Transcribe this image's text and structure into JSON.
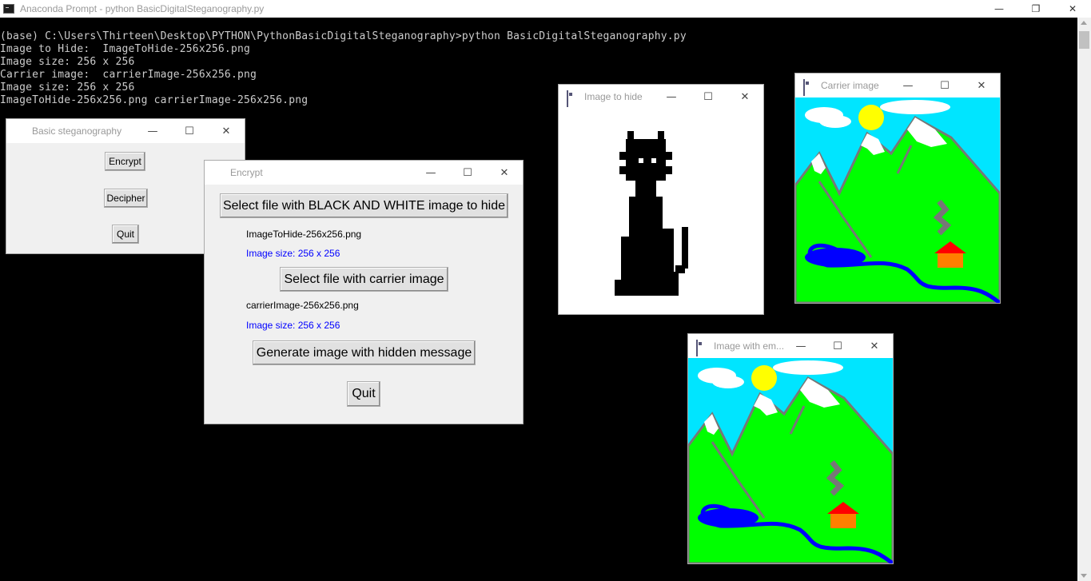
{
  "console": {
    "title": "Anaconda Prompt - python  BasicDigitalSteganography.py",
    "lines": [
      "(base) C:\\Users\\Thirteen\\Desktop\\PYTHON\\PythonBasicDigitalSteganography>python BasicDigitalSteganography.py",
      "Image to Hide:  ImageToHide-256x256.png",
      "Image size: 256 x 256",
      "Carrier image:  carrierImage-256x256.png",
      "Image size: 256 x 256",
      "ImageToHide-256x256.png carrierImage-256x256.png"
    ]
  },
  "controls": {
    "minimize": "—",
    "maximize": "☐",
    "restore": "❐",
    "close": "✕"
  },
  "main_window": {
    "title": "Basic steganography",
    "encrypt": "Encrypt",
    "decipher": "Decipher",
    "quit": "Quit"
  },
  "encrypt_window": {
    "title": "Encrypt",
    "select_bw": "Select file with BLACK AND WHITE image to hide",
    "hide_filename": "ImageToHide-256x256.png",
    "hide_size": "Image size: 256 x 256",
    "select_carrier": "Select file with carrier image",
    "carrier_filename": "carrierImage-256x256.png",
    "carrier_size": "Image size: 256 x 256",
    "generate": "Generate image with hidden message",
    "quit": "Quit"
  },
  "hide_window": {
    "title": "Image to hide"
  },
  "carrier_window": {
    "title": "Carrier image"
  },
  "result_window": {
    "title": "Image with em..."
  },
  "colors": {
    "sky": "#00e5ff",
    "grass": "#00ff00",
    "water": "#0000ff",
    "sun": "#ffff00",
    "size_label": "#0000ff"
  }
}
